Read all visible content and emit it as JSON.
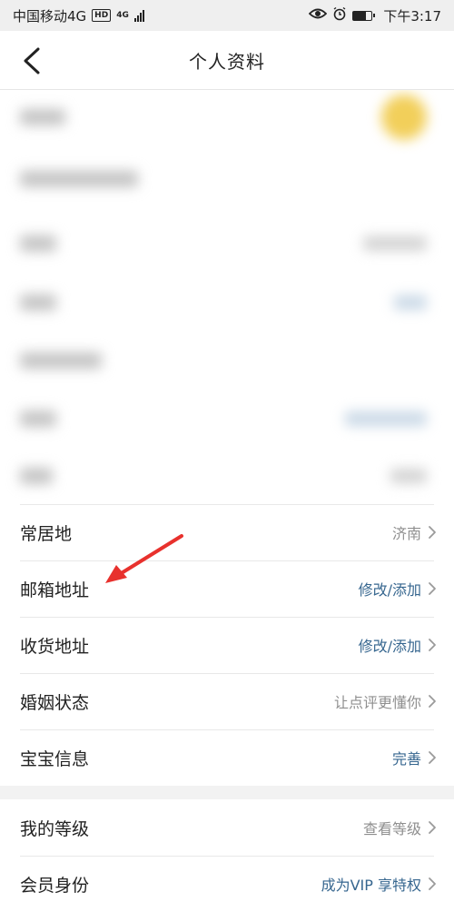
{
  "status_bar": {
    "carrier": "中国移动4G",
    "hd": "HD",
    "network": "4G",
    "time": "下午3:17"
  },
  "nav": {
    "title": "个人资料"
  },
  "rows": [
    {
      "label": "常居地",
      "value": "济南",
      "value_color": "gray"
    },
    {
      "label": "邮箱地址",
      "value": "修改/添加",
      "value_color": "blue"
    },
    {
      "label": "收货地址",
      "value": "修改/添加",
      "value_color": "blue"
    },
    {
      "label": "婚姻状态",
      "value": "让点评更懂你",
      "value_color": "gray"
    },
    {
      "label": "宝宝信息",
      "value": "完善",
      "value_color": "blue"
    }
  ],
  "rows2": [
    {
      "label": "我的等级",
      "value": "查看等级",
      "value_color": "gray"
    },
    {
      "label": "会员身份",
      "value": "成为VIP 享特权",
      "value_color": "blue"
    }
  ],
  "colors": {
    "blue_value": "#36668f",
    "gray_value": "#8f8f8f",
    "annotation_arrow": "#e8312d"
  }
}
